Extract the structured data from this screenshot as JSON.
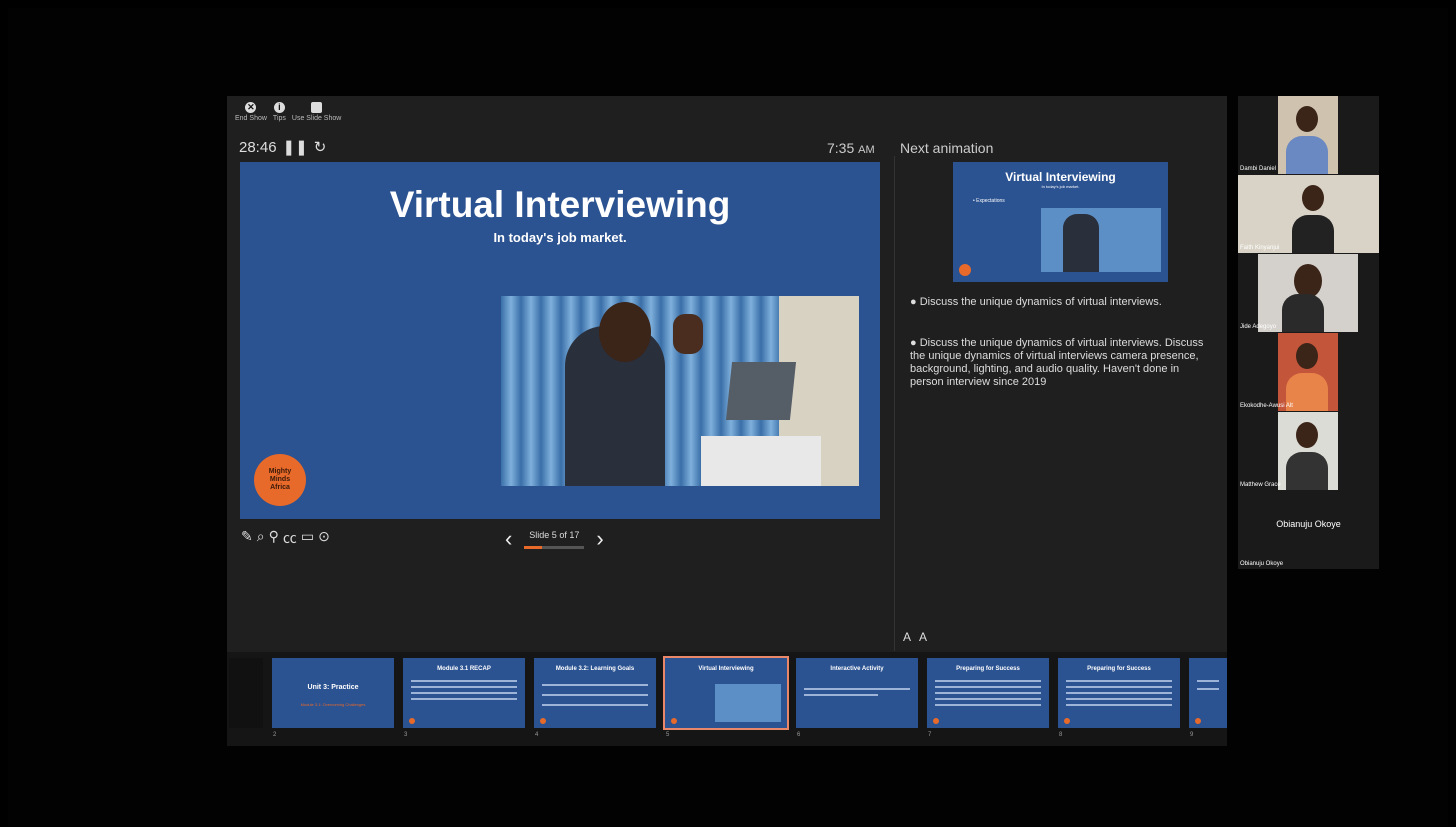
{
  "toolbar": {
    "end_show": "End Show",
    "tips": "Tips",
    "use_slide_show": "Use Slide Show"
  },
  "timer": "28:46",
  "clock": {
    "time": "7:35",
    "ampm": "AM"
  },
  "next_animation_label": "Next animation",
  "slide": {
    "title": "Virtual Interviewing",
    "subtitle": "In today's job market.",
    "logo_text": "Mighty Minds Africa"
  },
  "navigation": {
    "counter": "Slide 5 of 17",
    "progress": 0.29
  },
  "preview": {
    "title": "Virtual Interviewing",
    "subtitle": "In today's job market.",
    "bullet": "• Expectations"
  },
  "notes": [
    "●   Discuss the unique dynamics of virtual interviews.",
    "●   Discuss the unique dynamics of virtual interviews. Discuss the unique dynamics of virtual interviews camera presence, background, lighting, and audio quality. Haven't done in person interview since 2019"
  ],
  "font_controls": {
    "decrease": "A",
    "increase": "A"
  },
  "thumbnails": [
    {
      "num": "2",
      "title": "Unit 3: Practice",
      "red": "Module 3.1: Overcoming Challenges"
    },
    {
      "num": "3",
      "title": "Module 3.1 RECAP"
    },
    {
      "num": "4",
      "title": "Module 3.2: Learning Goals"
    },
    {
      "num": "5",
      "title": "Virtual Interviewing"
    },
    {
      "num": "6",
      "title": "Interactive Activity"
    },
    {
      "num": "7",
      "title": "Preparing for Success"
    },
    {
      "num": "8",
      "title": "Preparing for Success"
    },
    {
      "num": "9",
      "title": ""
    }
  ],
  "participants": [
    {
      "name": "Dambi Daniel"
    },
    {
      "name": "Faith Kinyanjui"
    },
    {
      "name": "Jide Adegoyo"
    },
    {
      "name": "Ekokodhe-Awusi Alt"
    },
    {
      "name": "Matthew Grace"
    },
    {
      "name": "Obianuju Okoye",
      "label": "Obianuju Okoye"
    }
  ],
  "colors": {
    "slide_blue": "#2b5291",
    "accent_orange": "#e86a2a",
    "selected_outline": "#e8876a"
  }
}
